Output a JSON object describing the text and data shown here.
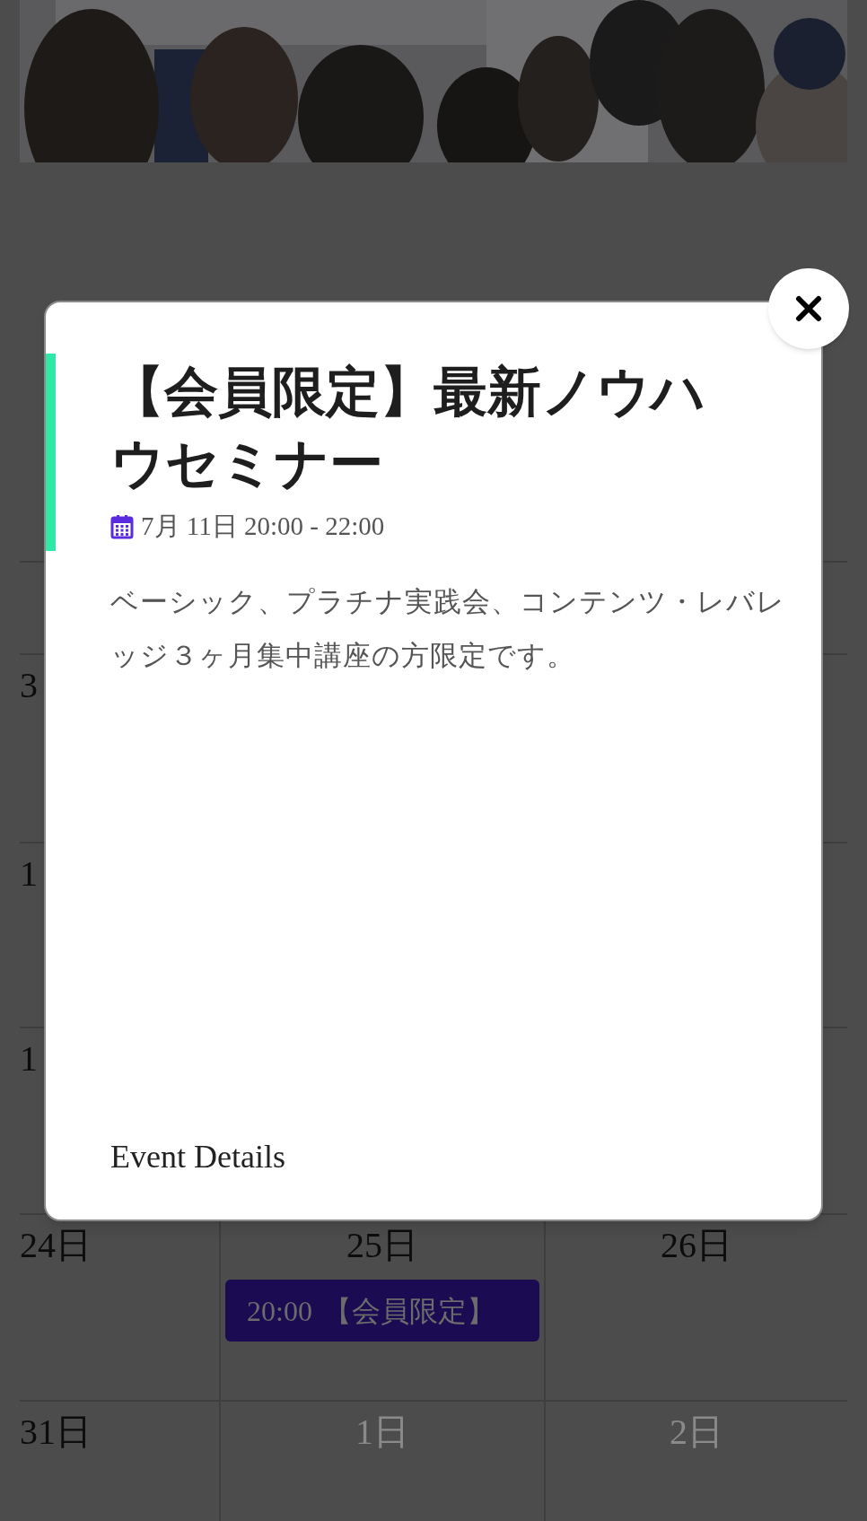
{
  "calendar": {
    "rows": [
      {
        "cells": [
          {},
          {},
          {}
        ]
      },
      {
        "cells": [
          {
            "day": "3"
          },
          {},
          {}
        ]
      },
      {
        "cells": [
          {
            "day": "1"
          },
          {},
          {}
        ]
      },
      {
        "cells": [
          {
            "day": "1"
          },
          {},
          {}
        ]
      },
      {
        "cells": [
          {
            "day": "24日"
          },
          {
            "day": "25日",
            "events": [
              {
                "time": "20:00",
                "title": "【会員限定】"
              }
            ]
          },
          {
            "day": "26日"
          }
        ]
      },
      {
        "cells": [
          {
            "day": "31日",
            "other_month": false
          },
          {
            "day": "1日",
            "other_month": true
          },
          {
            "day": "2日",
            "other_month": true
          }
        ]
      }
    ]
  },
  "modal": {
    "title": "【会員限定】最新ノウハウセミナー",
    "date": "7月 11日 20:00 - 22:00",
    "description": "ベーシック、プラチナ実践会、コンテンツ・レバレッジ３ヶ月集中講座の方限定です。",
    "link": "Event Details"
  }
}
